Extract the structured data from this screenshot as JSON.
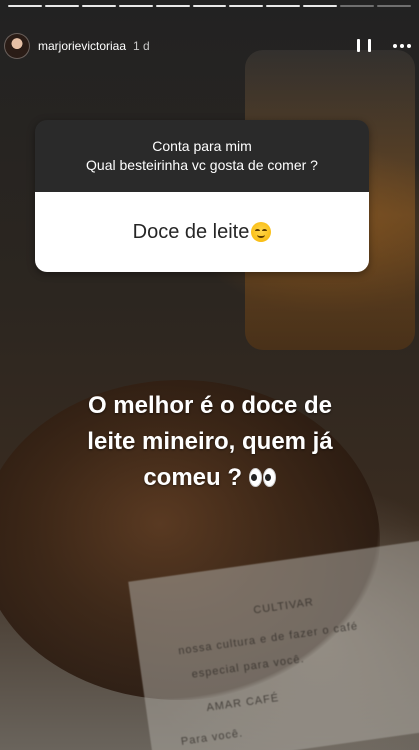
{
  "story": {
    "progress_segments": 11,
    "progress_completed": 9,
    "username": "marjorievictoriaa",
    "time": "1 d",
    "question": {
      "line1": "Conta para mim",
      "line2": "Qual besteirinha vc gosta de comer ?",
      "answer": "Doce de leite"
    },
    "caption": {
      "line1": "O melhor é o doce de",
      "line2": "leite mineiro, quem já",
      "line3": "comeu ?"
    },
    "background_text": [
      "CULTIVAR",
      "nossa cultura e de fazer o café",
      "especial para você.",
      "AMAR CAFÉ",
      "Para você."
    ],
    "icons": {
      "pause": "pause-icon",
      "more": "more-options-icon",
      "answer_emoji": "relieved-face-emoji",
      "caption_emoji": "eyes-emoji"
    }
  }
}
